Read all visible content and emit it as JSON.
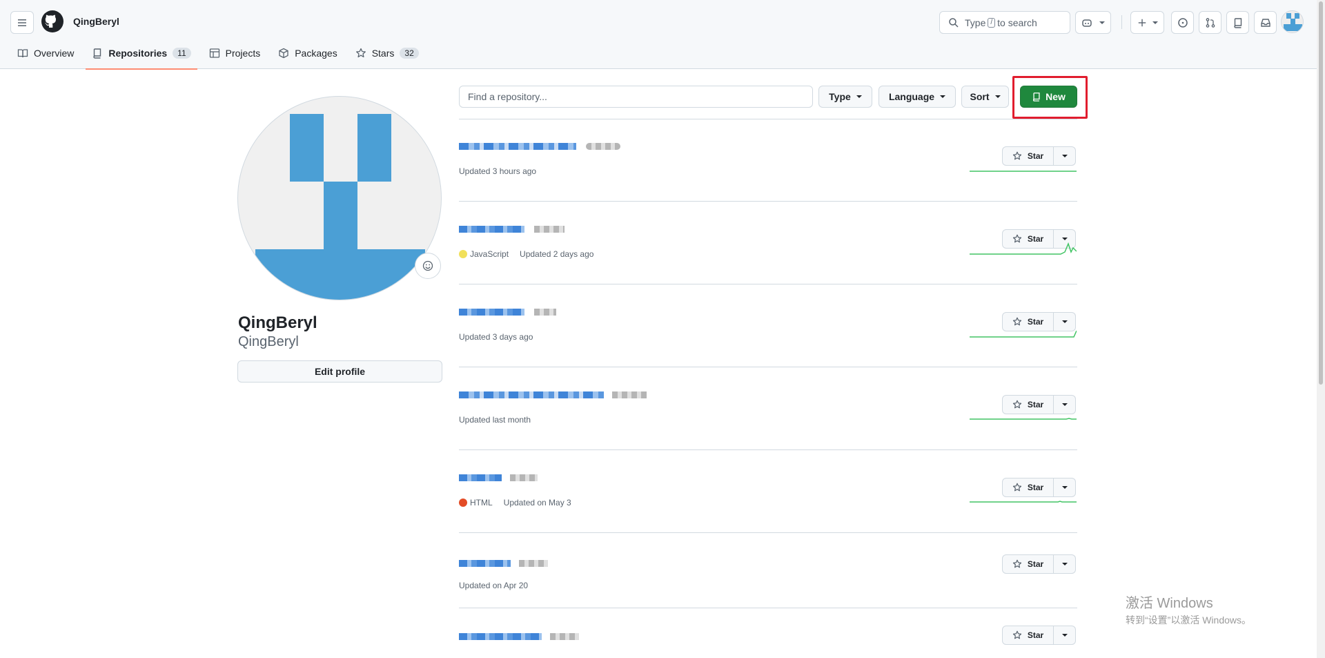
{
  "header": {
    "username": "QingBeryl",
    "search_prefix": "Type",
    "search_key": "/",
    "search_suffix": "to search"
  },
  "tabs": [
    {
      "label": "Overview",
      "icon": "book-icon"
    },
    {
      "label": "Repositories",
      "icon": "repo-icon",
      "count": "11"
    },
    {
      "label": "Projects",
      "icon": "table-icon"
    },
    {
      "label": "Packages",
      "icon": "package-icon"
    },
    {
      "label": "Stars",
      "icon": "star-icon",
      "count": "32"
    }
  ],
  "profile": {
    "name": "QingBeryl",
    "login": "QingBeryl",
    "edit_label": "Edit profile"
  },
  "filters": {
    "search_placeholder": "Find a repository...",
    "type_label": "Type",
    "language_label": "Language",
    "sort_label": "Sort",
    "new_label": "New"
  },
  "repos": [
    {
      "language": "",
      "lang_color": "",
      "updated": "Updated 3 hours ago",
      "star_label": "Star"
    },
    {
      "language": "JavaScript",
      "lang_color": "#f1e05a",
      "updated": "Updated 2 days ago",
      "star_label": "Star"
    },
    {
      "language": "",
      "lang_color": "",
      "updated": "Updated 3 days ago",
      "star_label": "Star"
    },
    {
      "language": "",
      "lang_color": "",
      "updated": "Updated last month",
      "star_label": "Star"
    },
    {
      "language": "HTML",
      "lang_color": "#e34c26",
      "updated": "Updated on May 3",
      "star_label": "Star"
    },
    {
      "language": "",
      "lang_color": "",
      "updated": "Updated on Apr 20",
      "star_label": "Star"
    },
    {
      "language": "",
      "lang_color": "",
      "updated": "",
      "star_label": "Star"
    }
  ],
  "watermark": {
    "title": "激活 Windows",
    "subtitle": "转到“设置”以激活 Windows。"
  },
  "colors": {
    "accent_green": "#1f883d",
    "tab_underline": "#fd8c73",
    "highlight_red": "#e11d2e",
    "avatar_blue": "#4b9fd5"
  }
}
